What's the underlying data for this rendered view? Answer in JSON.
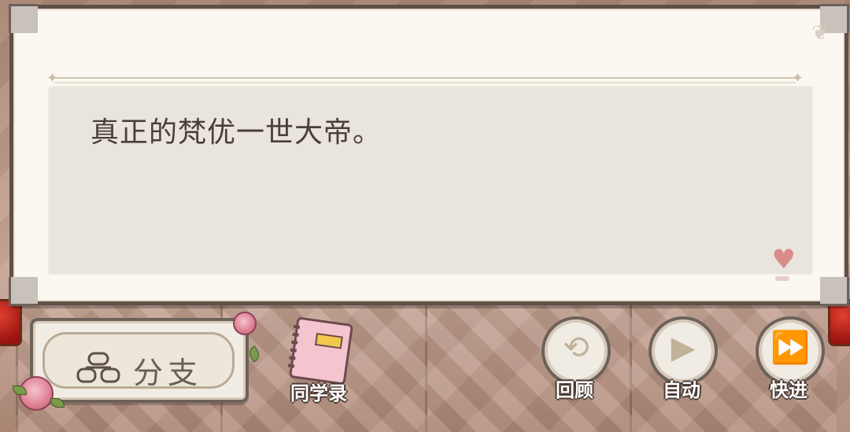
{
  "dialog": {
    "text": "真正的梵优一世大帝。"
  },
  "controls": {
    "branch_label": "分支",
    "yearbook_label": "同学录",
    "review_label": "回顾",
    "auto_label": "自动",
    "skip_label": "快进"
  },
  "icons": {
    "branch": "people-icon",
    "yearbook": "notebook-icon",
    "review": "history-clock-icon",
    "auto": "play-icon",
    "skip": "fast-forward-icon",
    "advance": "heart-icon"
  },
  "colors": {
    "panel": "#fbf8f1",
    "text_area": "#e9e4dc",
    "border": "#5e5048",
    "text": "#4a3e3a",
    "heart": "#d98c8a"
  }
}
